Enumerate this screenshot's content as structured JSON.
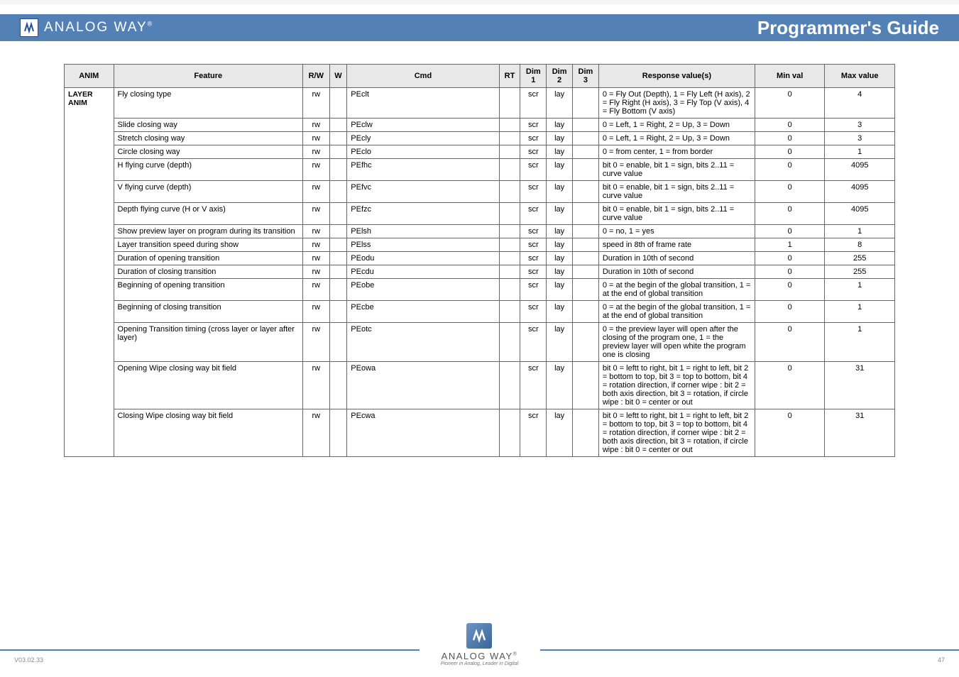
{
  "header": {
    "brand": "ANALOG WAY",
    "regmark": "®",
    "title": "Programmer's Guide"
  },
  "table": {
    "headers": [
      "ANIM",
      "Feature",
      "R/W",
      "W",
      "Cmd",
      "RT",
      "Dim 1",
      "Dim 2",
      "Dim 3",
      "Response value(s)",
      "Min val",
      "Max value"
    ],
    "section_label": "LAYER ANIM",
    "rows": [
      {
        "feature": "Fly closing type",
        "rw": "rw",
        "w": "",
        "cmd": "PEclt",
        "rt": "",
        "d1": "scr",
        "d2": "lay",
        "d3": "",
        "resp": "0 = Fly Out (Depth), 1 = Fly Left (H axis), 2 = Fly Right (H axis), 3 = Fly Top (V axis), 4 = Fly Bottom (V axis)",
        "min": "0",
        "max": "4"
      },
      {
        "feature": "Slide closing way",
        "rw": "rw",
        "w": "",
        "cmd": "PEclw",
        "rt": "",
        "d1": "scr",
        "d2": "lay",
        "d3": "",
        "resp": "0 = Left, 1 = Right, 2 = Up, 3 = Down",
        "min": "0",
        "max": "3"
      },
      {
        "feature": "Stretch closing way",
        "rw": "rw",
        "w": "",
        "cmd": "PEcly",
        "rt": "",
        "d1": "scr",
        "d2": "lay",
        "d3": "",
        "resp": "0 = Left, 1 = Right, 2 = Up, 3 = Down",
        "min": "0",
        "max": "3"
      },
      {
        "feature": "Circle closing way",
        "rw": "rw",
        "w": "",
        "cmd": "PEclo",
        "rt": "",
        "d1": "scr",
        "d2": "lay",
        "d3": "",
        "resp": "0 = from center, 1 = from border",
        "min": "0",
        "max": "1"
      },
      {
        "feature": "H flying curve (depth)",
        "rw": "rw",
        "w": "",
        "cmd": "PEfhc",
        "rt": "",
        "d1": "scr",
        "d2": "lay",
        "d3": "",
        "resp": "bit 0 = enable, bit 1 = sign, bits 2..11 = curve value",
        "min": "0",
        "max": "4095"
      },
      {
        "feature": "V flying curve (depth)",
        "rw": "rw",
        "w": "",
        "cmd": "PEfvc",
        "rt": "",
        "d1": "scr",
        "d2": "lay",
        "d3": "",
        "resp": "bit 0 = enable, bit 1 = sign, bits 2..11 = curve value",
        "min": "0",
        "max": "4095"
      },
      {
        "feature": "Depth flying curve (H or V axis)",
        "rw": "rw",
        "w": "",
        "cmd": "PEfzc",
        "rt": "",
        "d1": "scr",
        "d2": "lay",
        "d3": "",
        "resp": "bit 0 = enable, bit 1 = sign, bits 2..11 = curve value",
        "min": "0",
        "max": "4095"
      },
      {
        "feature": "Show preview layer on program during its transition",
        "rw": "rw",
        "w": "",
        "cmd": "PElsh",
        "rt": "",
        "d1": "scr",
        "d2": "lay",
        "d3": "",
        "resp": "0 = no, 1 = yes",
        "min": "0",
        "max": "1"
      },
      {
        "feature": "Layer transition speed during show",
        "rw": "rw",
        "w": "",
        "cmd": "PElss",
        "rt": "",
        "d1": "scr",
        "d2": "lay",
        "d3": "",
        "resp": "speed in 8th of frame rate",
        "min": "1",
        "max": "8"
      },
      {
        "feature": "Duration of opening transition",
        "rw": "rw",
        "w": "",
        "cmd": "PEodu",
        "rt": "",
        "d1": "scr",
        "d2": "lay",
        "d3": "",
        "resp": "Duration in 10th of second",
        "min": "0",
        "max": "255"
      },
      {
        "feature": "Duration of closing transition",
        "rw": "rw",
        "w": "",
        "cmd": "PEcdu",
        "rt": "",
        "d1": "scr",
        "d2": "lay",
        "d3": "",
        "resp": "Duration in 10th of second",
        "min": "0",
        "max": "255"
      },
      {
        "feature": "Beginning of opening transition",
        "rw": "rw",
        "w": "",
        "cmd": "PEobe",
        "rt": "",
        "d1": "scr",
        "d2": "lay",
        "d3": "",
        "resp": "0 = at the begin of the global transition, 1 = at the end of global transition",
        "min": "0",
        "max": "1"
      },
      {
        "feature": "Beginning of closing transition",
        "rw": "rw",
        "w": "",
        "cmd": "PEcbe",
        "rt": "",
        "d1": "scr",
        "d2": "lay",
        "d3": "",
        "resp": "0 = at the begin of the global transition, 1 = at the end of global transition",
        "min": "0",
        "max": "1"
      },
      {
        "feature": "Opening Transition timing (cross layer or layer after layer)",
        "rw": "rw",
        "w": "",
        "cmd": "PEotc",
        "rt": "",
        "d1": "scr",
        "d2": "lay",
        "d3": "",
        "resp": "0 = the preview layer will open after the closing of the program one, 1 = the preview layer will open white the program one is closing",
        "min": "0",
        "max": "1"
      },
      {
        "feature": "Opening Wipe closing way bit field",
        "rw": "rw",
        "w": "",
        "cmd": "PEowa",
        "rt": "",
        "d1": "scr",
        "d2": "lay",
        "d3": "",
        "resp": "bit 0 = leftt to right, bit 1 = right to left, bit 2 = bottom to top, bit 3 = top to bottom, bit 4 = rotation direction, if corner wipe : bit 2 = both axis direction, bit 3 = rotation, if circle wipe : bit 0 = center or out",
        "min": "0",
        "max": "31"
      },
      {
        "feature": "Closing Wipe closing way bit field",
        "rw": "rw",
        "w": "",
        "cmd": "PEcwa",
        "rt": "",
        "d1": "scr",
        "d2": "lay",
        "d3": "",
        "resp": "bit 0 = leftt to right, bit 1 = right to left, bit 2 = bottom to top, bit 3 = top to bottom, bit 4 = rotation direction, if corner wipe : bit 2 = both axis direction, bit 3 = rotation, if circle wipe : bit 0 = center or out",
        "min": "0",
        "max": "31"
      }
    ]
  },
  "footer": {
    "brand": "ANALOG WAY",
    "regmark": "®",
    "tagline": "Pioneer in Analog, Leader in Digital",
    "page": "47",
    "version": "V03.02.33"
  }
}
